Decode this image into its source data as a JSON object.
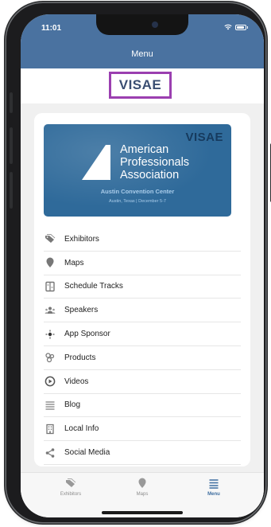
{
  "status_bar": {
    "time": "11:01"
  },
  "header": {
    "title": "Menu"
  },
  "logo": {
    "text": "VISAE"
  },
  "banner": {
    "brand": "VISAE",
    "org_line1": "American",
    "org_line2": "Professionals",
    "org_line3": "Association",
    "venue": "Austin Convention Center",
    "dates": "Austin, Texas | December 5-7"
  },
  "menu": {
    "items": [
      {
        "label": "Exhibitors",
        "icon": "tag-icon"
      },
      {
        "label": "Maps",
        "icon": "map-pin-icon"
      },
      {
        "label": "Schedule Tracks",
        "icon": "schedule-icon"
      },
      {
        "label": "Speakers",
        "icon": "speakers-icon"
      },
      {
        "label": "App Sponsor",
        "icon": "sponsor-star-icon"
      },
      {
        "label": "Products",
        "icon": "products-icon"
      },
      {
        "label": "Videos",
        "icon": "play-icon"
      },
      {
        "label": "Blog",
        "icon": "list-icon"
      },
      {
        "label": "Local Info",
        "icon": "building-icon"
      },
      {
        "label": "Social Media",
        "icon": "share-icon"
      }
    ]
  },
  "tabbar": {
    "tabs": [
      {
        "label": "Exhibitors",
        "icon": "tag-icon",
        "active": false
      },
      {
        "label": "Maps",
        "icon": "map-pin-icon",
        "active": false
      },
      {
        "label": "Menu",
        "icon": "menu-icon",
        "active": true
      }
    ]
  },
  "colors": {
    "header_blue": "#4a72a0",
    "banner_blue": "#2f6a9a",
    "logo_border": "#9b3fb0",
    "active_tab": "#3f6ea0"
  }
}
